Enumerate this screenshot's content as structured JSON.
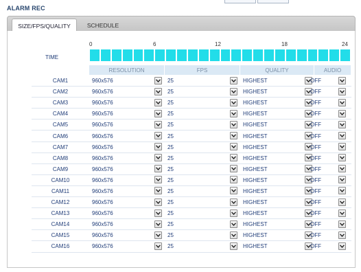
{
  "page_title": "ALARM REC",
  "tabs": [
    {
      "label": "SIZE/FPS/QUALITY",
      "active": true
    },
    {
      "label": "SCHEDULE",
      "active": false
    }
  ],
  "time": {
    "label": "TIME",
    "ticks": [
      "0",
      "6",
      "12",
      "18",
      "24"
    ],
    "hours_enabled": 24
  },
  "columns": {
    "resolution": "RESOLUTION",
    "fps": "FPS",
    "quality": "QUALITY",
    "audio": "AUDIO"
  },
  "cameras": [
    {
      "name": "CAM1",
      "resolution": "960x576",
      "fps": "25",
      "quality": "HIGHEST",
      "audio": "OFF"
    },
    {
      "name": "CAM2",
      "resolution": "960x576",
      "fps": "25",
      "quality": "HIGHEST",
      "audio": "OFF"
    },
    {
      "name": "CAM3",
      "resolution": "960x576",
      "fps": "25",
      "quality": "HIGHEST",
      "audio": "OFF"
    },
    {
      "name": "CAM4",
      "resolution": "960x576",
      "fps": "25",
      "quality": "HIGHEST",
      "audio": "OFF"
    },
    {
      "name": "CAM5",
      "resolution": "960x576",
      "fps": "25",
      "quality": "HIGHEST",
      "audio": "OFF"
    },
    {
      "name": "CAM6",
      "resolution": "960x576",
      "fps": "25",
      "quality": "HIGHEST",
      "audio": "OFF"
    },
    {
      "name": "CAM7",
      "resolution": "960x576",
      "fps": "25",
      "quality": "HIGHEST",
      "audio": "OFF"
    },
    {
      "name": "CAM8",
      "resolution": "960x576",
      "fps": "25",
      "quality": "HIGHEST",
      "audio": "OFF"
    },
    {
      "name": "CAM9",
      "resolution": "960x576",
      "fps": "25",
      "quality": "HIGHEST",
      "audio": "OFF"
    },
    {
      "name": "CAM10",
      "resolution": "960x576",
      "fps": "25",
      "quality": "HIGHEST",
      "audio": "OFF"
    },
    {
      "name": "CAM11",
      "resolution": "960x576",
      "fps": "25",
      "quality": "HIGHEST",
      "audio": "OFF"
    },
    {
      "name": "CAM12",
      "resolution": "960x576",
      "fps": "25",
      "quality": "HIGHEST",
      "audio": "OFF"
    },
    {
      "name": "CAM13",
      "resolution": "960x576",
      "fps": "25",
      "quality": "HIGHEST",
      "audio": "OFF"
    },
    {
      "name": "CAM14",
      "resolution": "960x576",
      "fps": "25",
      "quality": "HIGHEST",
      "audio": "OFF"
    },
    {
      "name": "CAM15",
      "resolution": "960x576",
      "fps": "25",
      "quality": "HIGHEST",
      "audio": "OFF"
    },
    {
      "name": "CAM16",
      "resolution": "960x576",
      "fps": "25",
      "quality": "HIGHEST",
      "audio": "OFF"
    }
  ],
  "colors": {
    "schedule_on": "#22dde9",
    "header_bg": "#dbe9f5",
    "label_text": "#1f3c78"
  },
  "icons": {
    "dropdown": "chevron-down-icon"
  }
}
